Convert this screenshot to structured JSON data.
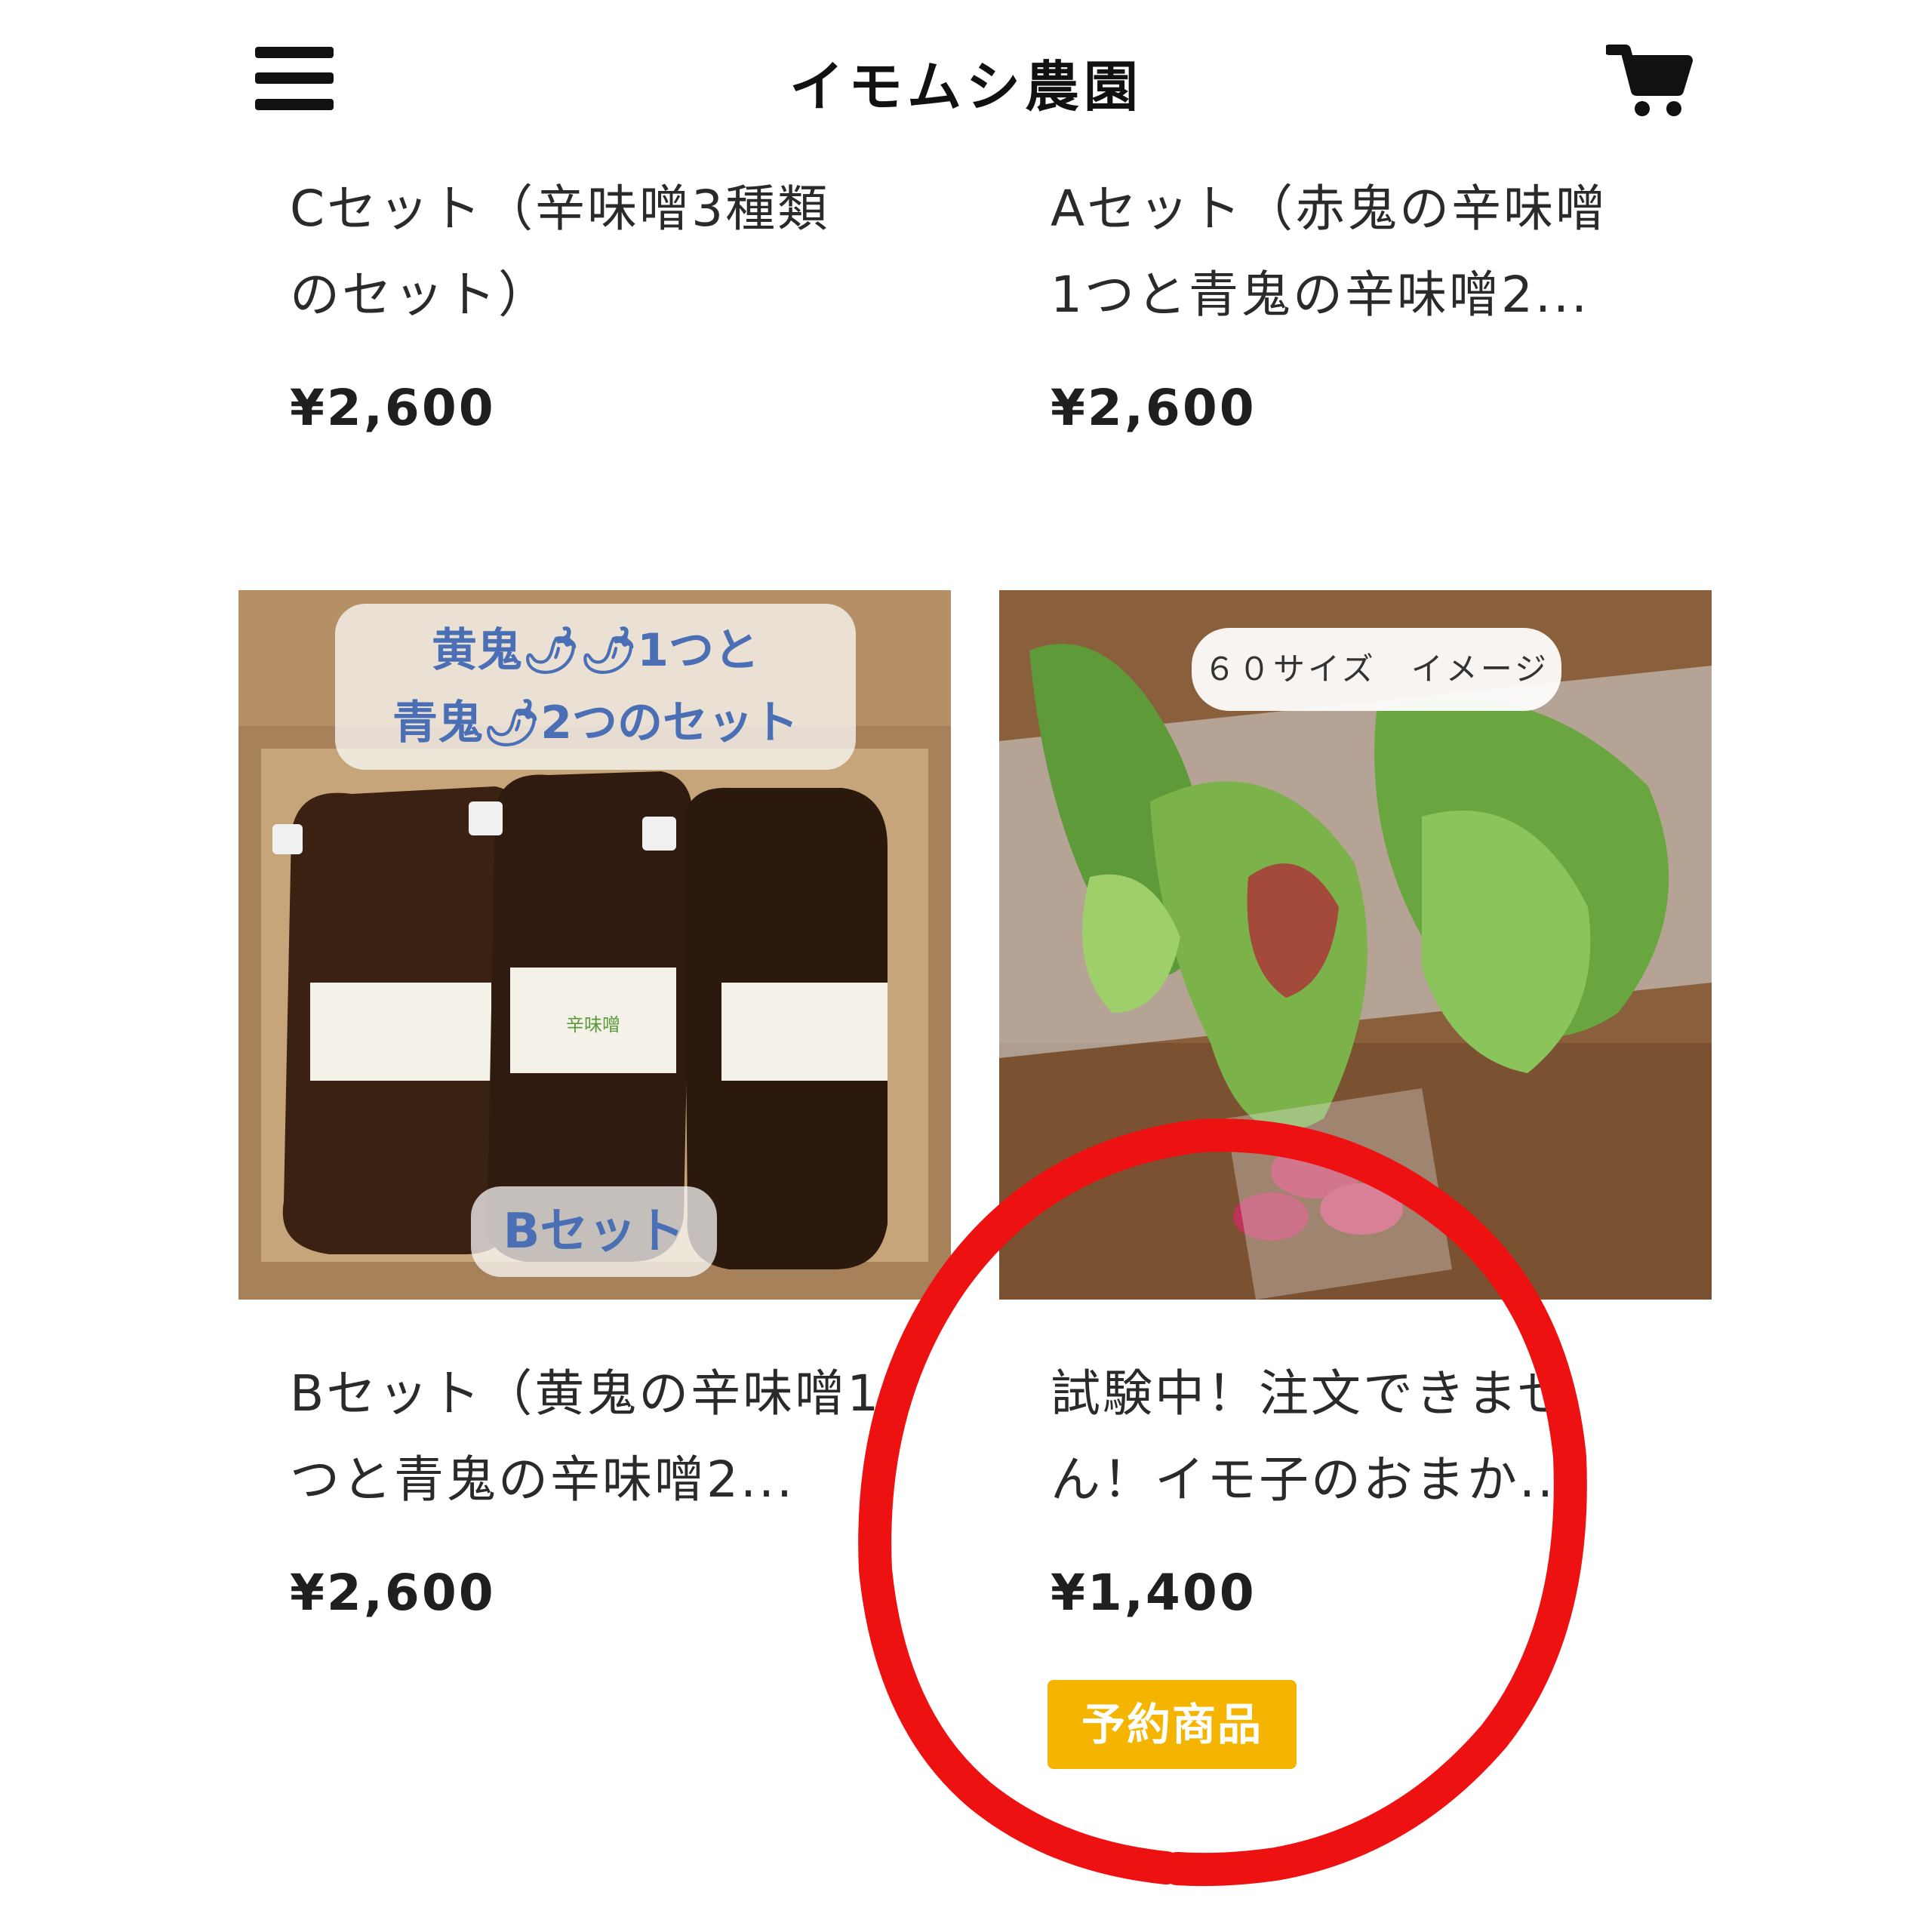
{
  "header": {
    "title": "イモムシ農園",
    "menu_icon": "hamburger-menu-icon",
    "cart_icon": "shopping-cart-icon"
  },
  "products": [
    {
      "name_line1": "Cセット（辛味噌3種類",
      "name_line2": "のセット）",
      "price": "¥2,600"
    },
    {
      "name_line1": "Aセット（赤鬼の辛味噌",
      "name_line2": "1つと青鬼の辛味噌2...",
      "price": "¥2,600"
    },
    {
      "name_line1": "Bセット（黄鬼の辛味噌1",
      "name_line2": "つと青鬼の辛味噌2...",
      "price": "¥2,600",
      "image_overlay_line1": "黄鬼🌶🌶1つと",
      "image_overlay_line2": "青鬼🌶2つのセット",
      "image_overlay_bottom": "Bセット",
      "package_label": "辛味噌"
    },
    {
      "name_line1": "試験中！注文できませ",
      "name_line2": "ん！イモ子のおまか...",
      "price": "¥1,400",
      "image_overlay": "６０サイズ　イメージ",
      "badge": "予約商品"
    }
  ],
  "colors": {
    "badge": "#f5b400",
    "annotation_circle": "#ee1111",
    "overlay_text": "#4a6fb4"
  }
}
